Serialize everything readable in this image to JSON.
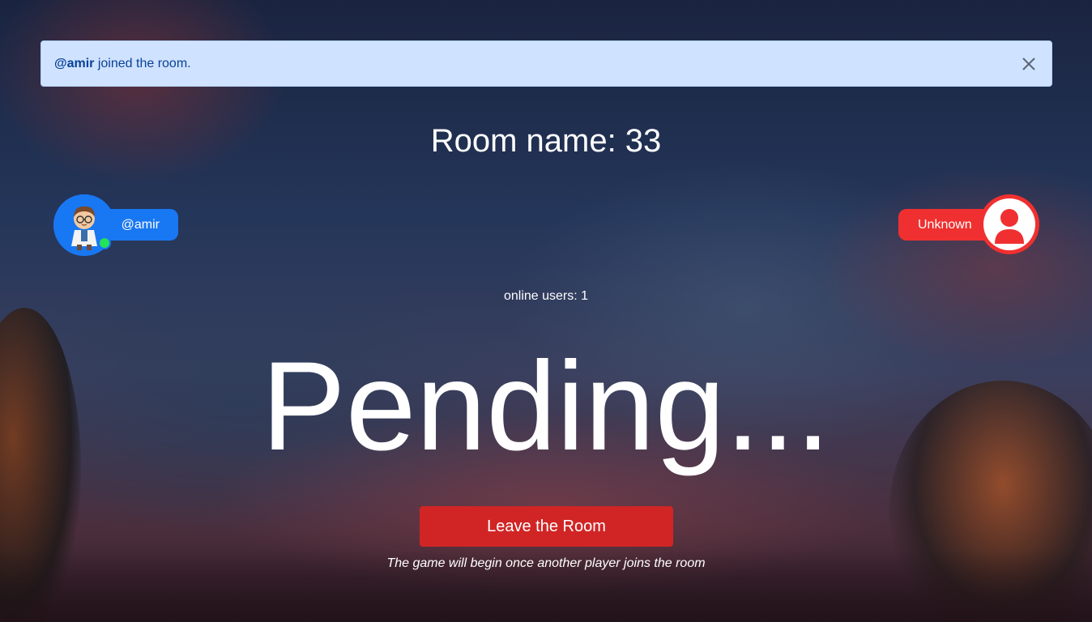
{
  "alert": {
    "username": "@amir",
    "message": " joined the room."
  },
  "room": {
    "title": "Room name: 33"
  },
  "players": {
    "left": {
      "name": "@amir",
      "status": "online",
      "accent": "#1877f2"
    },
    "right": {
      "name": "Unknown",
      "accent": "#f03030"
    }
  },
  "online_users": "online users: 1",
  "status_text": "Pending...",
  "actions": {
    "leave_label": "Leave the Room"
  },
  "hint": "The game will begin once another player joins the room",
  "icons": [
    "close-icon",
    "user-avatar",
    "default-user-icon",
    "online-status-dot"
  ],
  "colors": {
    "alert_bg": "#cfe2ff",
    "alert_text": "#084298",
    "leave_button": "#d12525",
    "online_dot": "#22e35a"
  }
}
